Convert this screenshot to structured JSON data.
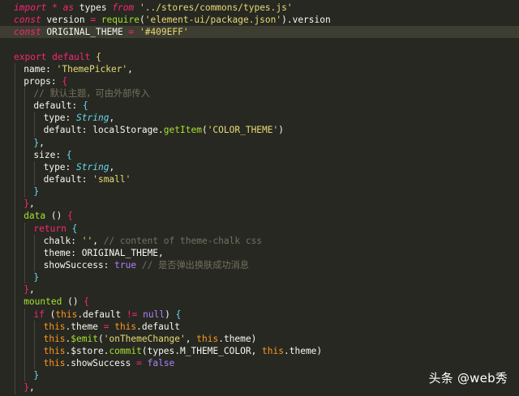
{
  "editor": {
    "lines": [
      {
        "active": false,
        "indent": 0,
        "tokens": [
          [
            "kwi",
            "import"
          ],
          [
            "pl",
            " "
          ],
          [
            "op",
            "*"
          ],
          [
            "pl",
            " "
          ],
          [
            "kwi",
            "as"
          ],
          [
            "pl",
            " types "
          ],
          [
            "kwi",
            "from"
          ],
          [
            "pl",
            " "
          ],
          [
            "str",
            "'../stores/commons/types.js'"
          ]
        ]
      },
      {
        "active": false,
        "indent": 0,
        "tokens": [
          [
            "kwi",
            "const"
          ],
          [
            "pl",
            " version "
          ],
          [
            "op",
            "="
          ],
          [
            "pl",
            " "
          ],
          [
            "fn",
            "require"
          ],
          [
            "pl",
            "("
          ],
          [
            "str",
            "'element-ui/package.json'"
          ],
          [
            "pl",
            ").version"
          ]
        ]
      },
      {
        "active": true,
        "indent": 0,
        "tokens": [
          [
            "kwi",
            "const"
          ],
          [
            "pl",
            " ORIGINAL_THEME "
          ],
          [
            "op",
            "="
          ],
          [
            "pl",
            " "
          ],
          [
            "str",
            "'#409EFF'"
          ]
        ]
      },
      {
        "active": false,
        "indent": 0,
        "tokens": []
      },
      {
        "active": false,
        "indent": 0,
        "tokens": [
          [
            "kw",
            "export"
          ],
          [
            "pl",
            " "
          ],
          [
            "kw",
            "default"
          ],
          [
            "pl",
            " "
          ],
          [
            "bracket-y",
            "{"
          ]
        ]
      },
      {
        "active": false,
        "indent": 1,
        "tokens": [
          [
            "pl",
            "name: "
          ],
          [
            "str",
            "'ThemePicker'"
          ],
          [
            "pl",
            ","
          ]
        ]
      },
      {
        "active": false,
        "indent": 1,
        "tokens": [
          [
            "pl",
            "props: "
          ],
          [
            "bracket-p",
            "{"
          ]
        ]
      },
      {
        "active": false,
        "indent": 2,
        "tokens": [
          [
            "cmt",
            "// 默认主题，可由外部传入"
          ]
        ]
      },
      {
        "active": false,
        "indent": 2,
        "tokens": [
          [
            "pl",
            "default: "
          ],
          [
            "bracket-b",
            "{"
          ]
        ]
      },
      {
        "active": false,
        "indent": 3,
        "tokens": [
          [
            "pl",
            "type: "
          ],
          [
            "typ",
            "String"
          ],
          [
            "pl",
            ","
          ]
        ]
      },
      {
        "active": false,
        "indent": 3,
        "tokens": [
          [
            "pl",
            "default: localStorage."
          ],
          [
            "fn",
            "getItem"
          ],
          [
            "pl",
            "("
          ],
          [
            "str",
            "'COLOR_THEME'"
          ],
          [
            "pl",
            ")"
          ]
        ]
      },
      {
        "active": false,
        "indent": 2,
        "tokens": [
          [
            "bracket-b",
            "}"
          ],
          [
            "pl",
            ","
          ]
        ]
      },
      {
        "active": false,
        "indent": 2,
        "tokens": [
          [
            "pl",
            "size: "
          ],
          [
            "bracket-b",
            "{"
          ]
        ]
      },
      {
        "active": false,
        "indent": 3,
        "tokens": [
          [
            "pl",
            "type: "
          ],
          [
            "typ",
            "String"
          ],
          [
            "pl",
            ","
          ]
        ]
      },
      {
        "active": false,
        "indent": 3,
        "tokens": [
          [
            "pl",
            "default: "
          ],
          [
            "str",
            "'small'"
          ]
        ]
      },
      {
        "active": false,
        "indent": 2,
        "tokens": [
          [
            "bracket-b",
            "}"
          ]
        ]
      },
      {
        "active": false,
        "indent": 1,
        "tokens": [
          [
            "bracket-p",
            "}"
          ],
          [
            "pl",
            ","
          ]
        ]
      },
      {
        "active": false,
        "indent": 1,
        "tokens": [
          [
            "fn",
            "data"
          ],
          [
            "pl",
            " () "
          ],
          [
            "bracket-p",
            "{"
          ]
        ]
      },
      {
        "active": false,
        "indent": 2,
        "tokens": [
          [
            "kw",
            "return"
          ],
          [
            "pl",
            " "
          ],
          [
            "bracket-b",
            "{"
          ]
        ]
      },
      {
        "active": false,
        "indent": 3,
        "tokens": [
          [
            "pl",
            "chalk: "
          ],
          [
            "str",
            "''"
          ],
          [
            "pl",
            ", "
          ],
          [
            "cmt",
            "// content of theme-chalk css"
          ]
        ]
      },
      {
        "active": false,
        "indent": 3,
        "tokens": [
          [
            "pl",
            "theme: ORIGINAL_THEME,"
          ]
        ]
      },
      {
        "active": false,
        "indent": 3,
        "tokens": [
          [
            "pl",
            "showSuccess: "
          ],
          [
            "cn",
            "true"
          ],
          [
            "pl",
            " "
          ],
          [
            "cmt",
            "// 是否弹出换肤成功消息"
          ]
        ]
      },
      {
        "active": false,
        "indent": 2,
        "tokens": [
          [
            "bracket-b",
            "}"
          ]
        ]
      },
      {
        "active": false,
        "indent": 1,
        "tokens": [
          [
            "bracket-p",
            "}"
          ],
          [
            "pl",
            ","
          ]
        ]
      },
      {
        "active": false,
        "indent": 1,
        "tokens": [
          [
            "fn",
            "mounted"
          ],
          [
            "pl",
            " () "
          ],
          [
            "bracket-p",
            "{"
          ]
        ]
      },
      {
        "active": false,
        "indent": 2,
        "tokens": [
          [
            "kw",
            "if"
          ],
          [
            "pl",
            " ("
          ],
          [
            "this",
            "this"
          ],
          [
            "pl",
            ".default "
          ],
          [
            "op",
            "!="
          ],
          [
            "pl",
            " "
          ],
          [
            "cn",
            "null"
          ],
          [
            "pl",
            ") "
          ],
          [
            "bracket-b",
            "{"
          ]
        ]
      },
      {
        "active": false,
        "indent": 3,
        "tokens": [
          [
            "this",
            "this"
          ],
          [
            "pl",
            ".theme "
          ],
          [
            "op",
            "="
          ],
          [
            "pl",
            " "
          ],
          [
            "this",
            "this"
          ],
          [
            "pl",
            ".default"
          ]
        ]
      },
      {
        "active": false,
        "indent": 3,
        "tokens": [
          [
            "this",
            "this"
          ],
          [
            "pl",
            "."
          ],
          [
            "fn",
            "$emit"
          ],
          [
            "pl",
            "("
          ],
          [
            "str",
            "'onThemeChange'"
          ],
          [
            "pl",
            ", "
          ],
          [
            "this",
            "this"
          ],
          [
            "pl",
            ".theme)"
          ]
        ]
      },
      {
        "active": false,
        "indent": 3,
        "tokens": [
          [
            "this",
            "this"
          ],
          [
            "pl",
            ".$store."
          ],
          [
            "fn",
            "commit"
          ],
          [
            "pl",
            "(types.M_THEME_COLOR, "
          ],
          [
            "this",
            "this"
          ],
          [
            "pl",
            ".theme)"
          ]
        ]
      },
      {
        "active": false,
        "indent": 3,
        "tokens": [
          [
            "this",
            "this"
          ],
          [
            "pl",
            ".showSuccess "
          ],
          [
            "op",
            "="
          ],
          [
            "pl",
            " "
          ],
          [
            "cn",
            "false"
          ]
        ]
      },
      {
        "active": false,
        "indent": 2,
        "tokens": [
          [
            "bracket-b",
            "}"
          ]
        ]
      },
      {
        "active": false,
        "indent": 1,
        "tokens": [
          [
            "bracket-p",
            "}"
          ],
          [
            "pl",
            ","
          ]
        ]
      }
    ]
  },
  "watermark": {
    "text": "头条 @web秀"
  }
}
